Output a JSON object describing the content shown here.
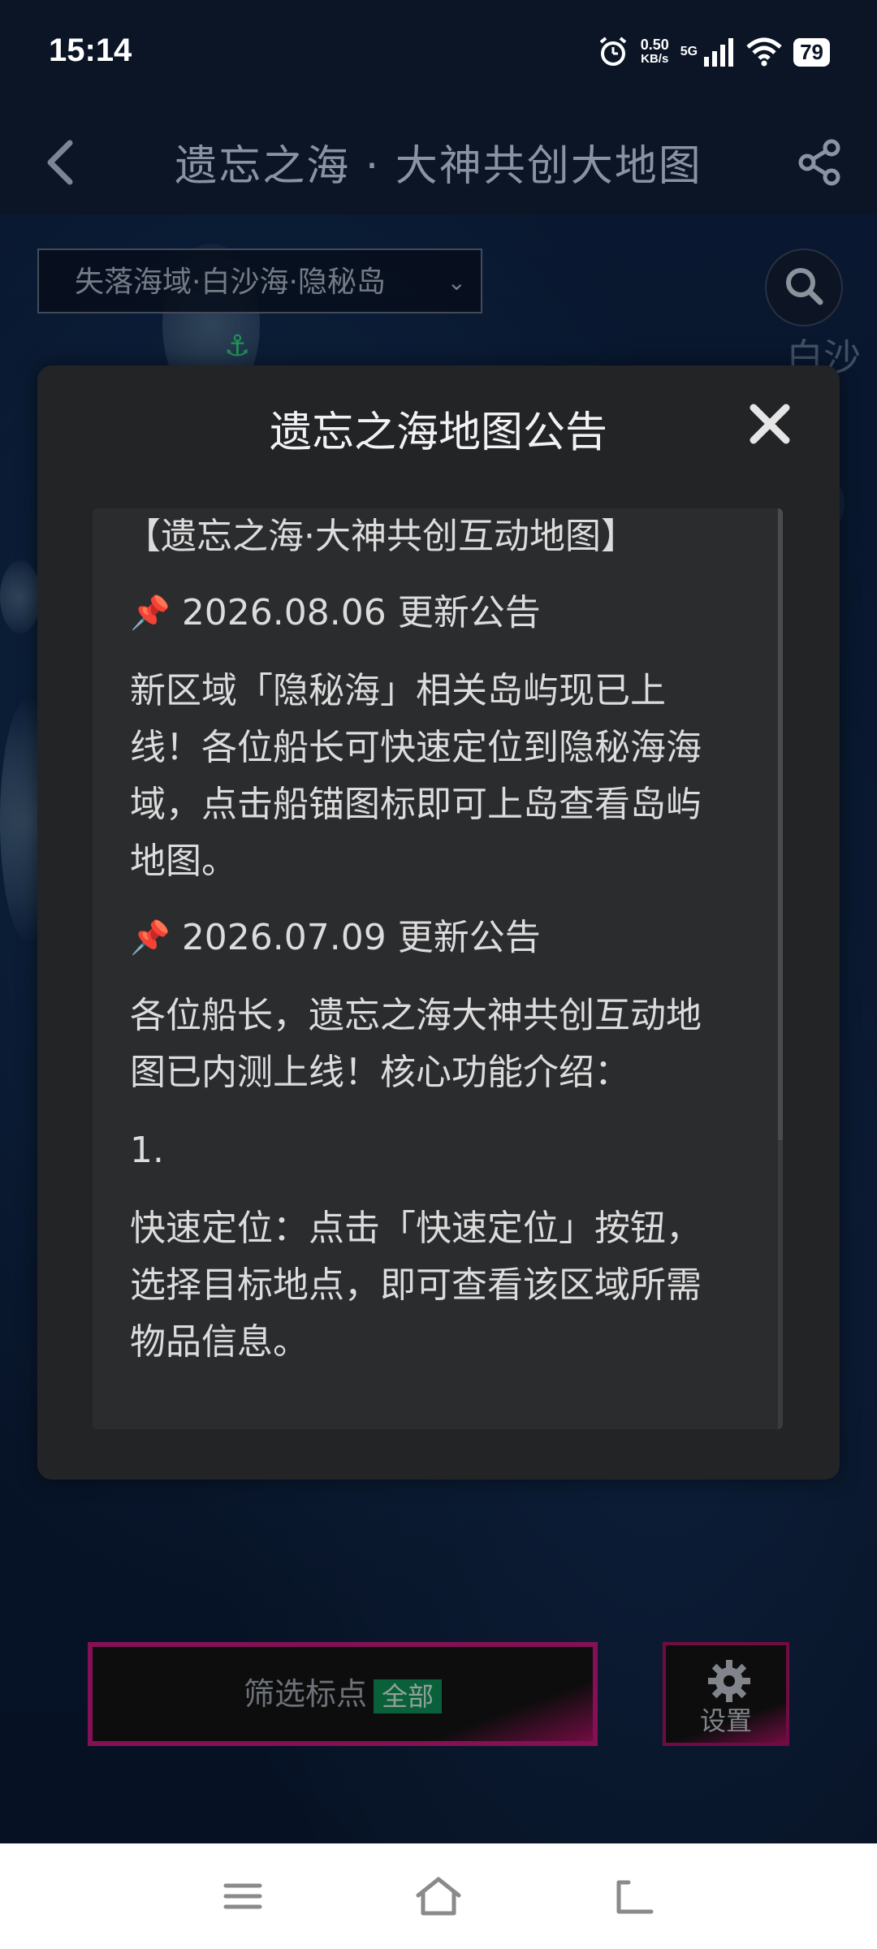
{
  "status_bar": {
    "time": "15:14",
    "net_speed_value": "0.50",
    "net_speed_unit": "KB/s",
    "signal_label": "5G",
    "battery": "79"
  },
  "header": {
    "title": "遗忘之海 · 大神共创大地图",
    "back_icon": "chevron-left-icon",
    "share_icon": "share-icon"
  },
  "map": {
    "location_selector": "失落海域·白沙海·隐秘岛",
    "right_label": "白沙",
    "anchor_icon": "anchor-icon"
  },
  "modal": {
    "title": "遗忘之海地图公告",
    "close_icon": "close-icon",
    "heading": "【遗忘之海·大神共创互动地图】",
    "sections": [
      {
        "pin_icon": "pushpin-icon",
        "date_title": "2026.08.06 更新公告",
        "lines": [
          "新区域「隐秘海」相关岛屿现已上",
          "线！各位船长可快速定位到隐秘海海",
          "域，点击船锚图标即可上岛查看岛屿",
          "地图。"
        ]
      },
      {
        "pin_icon": "pushpin-icon",
        "date_title": "2026.07.09 更新公告",
        "lines": [
          "各位船长，遗忘之海大神共创互动地",
          "图已内测上线！核心功能介绍："
        ]
      }
    ],
    "list_number": "1.",
    "feature_lines": [
      "快速定位：点击「快速定位」按钮，",
      "选择目标地点，即可查看该区域所需",
      "物品信息。"
    ]
  },
  "bottom": {
    "filter_label": "筛选标点",
    "filter_tag": "全部",
    "settings_label": "设置"
  },
  "colors": {
    "accent_magenta": "#c0187a",
    "tag_green": "#0e8a55",
    "modal_bg": "#232426"
  }
}
